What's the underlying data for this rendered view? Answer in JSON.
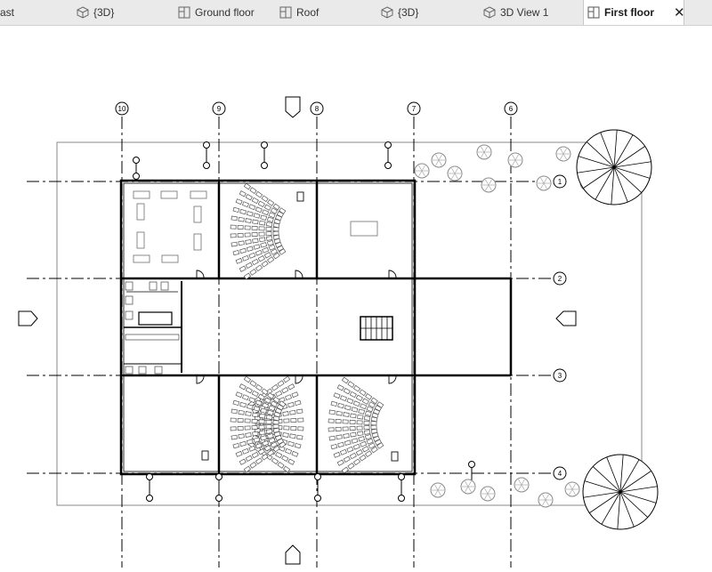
{
  "tabs": [
    {
      "label": "ast",
      "icon": "none",
      "active": false
    },
    {
      "label": "{3D}",
      "icon": "3d-view-icon",
      "active": false
    },
    {
      "label": "Ground floor",
      "icon": "floor-plan-icon",
      "active": false
    },
    {
      "label": "Roof",
      "icon": "floor-plan-icon",
      "active": false
    },
    {
      "label": "{3D}",
      "icon": "3d-view-icon",
      "active": false
    },
    {
      "label": "3D View 1",
      "icon": "3d-view-icon",
      "active": false
    },
    {
      "label": "First floor",
      "icon": "floor-plan-icon",
      "active": true
    }
  ],
  "close_glyph": "✕",
  "plan": {
    "vertical_grids": [
      "10",
      "9",
      "8",
      "7",
      "6"
    ],
    "horizontal_grids": [
      "1",
      "2",
      "3",
      "4"
    ]
  },
  "colors": {
    "tabbar_bg": "#eaeaea",
    "active_tab_bg": "#ffffff",
    "canvas_bg": "#ffffff",
    "wall": "#000000",
    "grid_line": "#000000",
    "furniture": "#6e6e6e"
  }
}
